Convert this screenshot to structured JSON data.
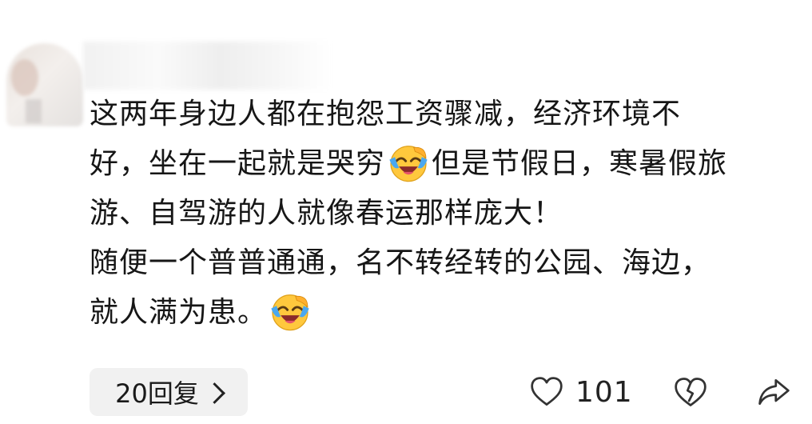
{
  "comment": {
    "lines": [
      {
        "text": "这两年身边人都在抱怨工资骤减，经济环境不"
      },
      {
        "before": "好，坐在一起就是哭穷",
        "emoji": "laughing-tears-emoji",
        "after": "但是节假日，寒暑假旅"
      },
      {
        "text": "游、自驾游的人就像春运那样庞大！"
      },
      {
        "text": "随便一个普普通通，名不转经转的公园、海边，"
      },
      {
        "before": "就人满为患。",
        "emoji": "laughing-tears-emoji",
        "after": ""
      }
    ]
  },
  "actions": {
    "reply_label": "20回复",
    "chevron_icon": "chevron-right-icon",
    "like_icon": "heart-outline-icon",
    "like_count": "101",
    "dislike_icon": "broken-heart-icon",
    "share_icon": "share-arrow-icon"
  },
  "colors": {
    "text": "#161616",
    "reply_bg": "#f1f1f1",
    "emoji_face": "#ffc83d",
    "emoji_tear": "#4aa8f0"
  }
}
